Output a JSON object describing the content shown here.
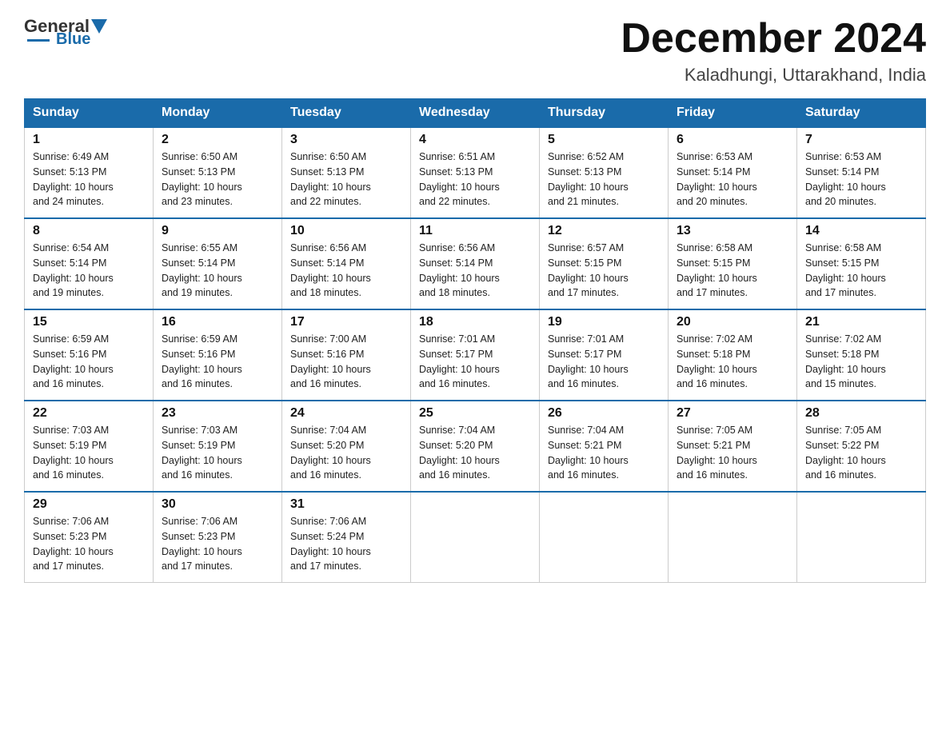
{
  "header": {
    "logo": {
      "general": "General",
      "blue": "Blue"
    },
    "title": "December 2024",
    "location": "Kaladhungi, Uttarakhand, India"
  },
  "weekdays": [
    "Sunday",
    "Monday",
    "Tuesday",
    "Wednesday",
    "Thursday",
    "Friday",
    "Saturday"
  ],
  "weeks": [
    [
      {
        "day": "1",
        "sunrise": "6:49 AM",
        "sunset": "5:13 PM",
        "daylight": "10 hours and 24 minutes."
      },
      {
        "day": "2",
        "sunrise": "6:50 AM",
        "sunset": "5:13 PM",
        "daylight": "10 hours and 23 minutes."
      },
      {
        "day": "3",
        "sunrise": "6:50 AM",
        "sunset": "5:13 PM",
        "daylight": "10 hours and 22 minutes."
      },
      {
        "day": "4",
        "sunrise": "6:51 AM",
        "sunset": "5:13 PM",
        "daylight": "10 hours and 22 minutes."
      },
      {
        "day": "5",
        "sunrise": "6:52 AM",
        "sunset": "5:13 PM",
        "daylight": "10 hours and 21 minutes."
      },
      {
        "day": "6",
        "sunrise": "6:53 AM",
        "sunset": "5:14 PM",
        "daylight": "10 hours and 20 minutes."
      },
      {
        "day": "7",
        "sunrise": "6:53 AM",
        "sunset": "5:14 PM",
        "daylight": "10 hours and 20 minutes."
      }
    ],
    [
      {
        "day": "8",
        "sunrise": "6:54 AM",
        "sunset": "5:14 PM",
        "daylight": "10 hours and 19 minutes."
      },
      {
        "day": "9",
        "sunrise": "6:55 AM",
        "sunset": "5:14 PM",
        "daylight": "10 hours and 19 minutes."
      },
      {
        "day": "10",
        "sunrise": "6:56 AM",
        "sunset": "5:14 PM",
        "daylight": "10 hours and 18 minutes."
      },
      {
        "day": "11",
        "sunrise": "6:56 AM",
        "sunset": "5:14 PM",
        "daylight": "10 hours and 18 minutes."
      },
      {
        "day": "12",
        "sunrise": "6:57 AM",
        "sunset": "5:15 PM",
        "daylight": "10 hours and 17 minutes."
      },
      {
        "day": "13",
        "sunrise": "6:58 AM",
        "sunset": "5:15 PM",
        "daylight": "10 hours and 17 minutes."
      },
      {
        "day": "14",
        "sunrise": "6:58 AM",
        "sunset": "5:15 PM",
        "daylight": "10 hours and 17 minutes."
      }
    ],
    [
      {
        "day": "15",
        "sunrise": "6:59 AM",
        "sunset": "5:16 PM",
        "daylight": "10 hours and 16 minutes."
      },
      {
        "day": "16",
        "sunrise": "6:59 AM",
        "sunset": "5:16 PM",
        "daylight": "10 hours and 16 minutes."
      },
      {
        "day": "17",
        "sunrise": "7:00 AM",
        "sunset": "5:16 PM",
        "daylight": "10 hours and 16 minutes."
      },
      {
        "day": "18",
        "sunrise": "7:01 AM",
        "sunset": "5:17 PM",
        "daylight": "10 hours and 16 minutes."
      },
      {
        "day": "19",
        "sunrise": "7:01 AM",
        "sunset": "5:17 PM",
        "daylight": "10 hours and 16 minutes."
      },
      {
        "day": "20",
        "sunrise": "7:02 AM",
        "sunset": "5:18 PM",
        "daylight": "10 hours and 16 minutes."
      },
      {
        "day": "21",
        "sunrise": "7:02 AM",
        "sunset": "5:18 PM",
        "daylight": "10 hours and 15 minutes."
      }
    ],
    [
      {
        "day": "22",
        "sunrise": "7:03 AM",
        "sunset": "5:19 PM",
        "daylight": "10 hours and 16 minutes."
      },
      {
        "day": "23",
        "sunrise": "7:03 AM",
        "sunset": "5:19 PM",
        "daylight": "10 hours and 16 minutes."
      },
      {
        "day": "24",
        "sunrise": "7:04 AM",
        "sunset": "5:20 PM",
        "daylight": "10 hours and 16 minutes."
      },
      {
        "day": "25",
        "sunrise": "7:04 AM",
        "sunset": "5:20 PM",
        "daylight": "10 hours and 16 minutes."
      },
      {
        "day": "26",
        "sunrise": "7:04 AM",
        "sunset": "5:21 PM",
        "daylight": "10 hours and 16 minutes."
      },
      {
        "day": "27",
        "sunrise": "7:05 AM",
        "sunset": "5:21 PM",
        "daylight": "10 hours and 16 minutes."
      },
      {
        "day": "28",
        "sunrise": "7:05 AM",
        "sunset": "5:22 PM",
        "daylight": "10 hours and 16 minutes."
      }
    ],
    [
      {
        "day": "29",
        "sunrise": "7:06 AM",
        "sunset": "5:23 PM",
        "daylight": "10 hours and 17 minutes."
      },
      {
        "day": "30",
        "sunrise": "7:06 AM",
        "sunset": "5:23 PM",
        "daylight": "10 hours and 17 minutes."
      },
      {
        "day": "31",
        "sunrise": "7:06 AM",
        "sunset": "5:24 PM",
        "daylight": "10 hours and 17 minutes."
      },
      null,
      null,
      null,
      null
    ]
  ],
  "labels": {
    "sunrise": "Sunrise:",
    "sunset": "Sunset:",
    "daylight": "Daylight:"
  }
}
